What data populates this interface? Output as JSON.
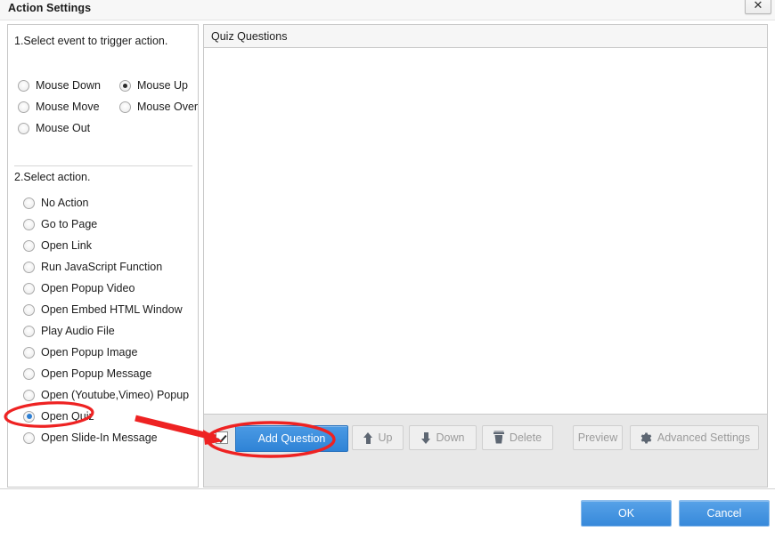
{
  "window": {
    "title": "Action Settings",
    "close_icon": "close-icon",
    "close_glyph": "✕"
  },
  "left_panel": {
    "section1_title": "1.Select event to trigger action.",
    "section2_title": "2.Select action.",
    "events": [
      {
        "label": "Mouse Down",
        "selected": false
      },
      {
        "label": "Mouse Up",
        "selected": true
      },
      {
        "label": "Mouse Move",
        "selected": false
      },
      {
        "label": "Mouse Over",
        "selected": false
      },
      {
        "label": "Mouse Out",
        "selected": false
      }
    ],
    "actions": [
      {
        "label": "No Action",
        "selected": false
      },
      {
        "label": "Go to Page",
        "selected": false
      },
      {
        "label": "Open Link",
        "selected": false
      },
      {
        "label": "Run JavaScript Function",
        "selected": false
      },
      {
        "label": "Open Popup Video",
        "selected": false
      },
      {
        "label": "Open Embed HTML Window",
        "selected": false
      },
      {
        "label": "Play Audio File",
        "selected": false
      },
      {
        "label": "Open Popup Image",
        "selected": false
      },
      {
        "label": "Open Popup Message",
        "selected": false
      },
      {
        "label": "Open (Youtube,Vimeo) Popup",
        "selected": false
      },
      {
        "label": "Open Quiz",
        "selected": true
      },
      {
        "label": "Open Slide-In Message",
        "selected": false
      }
    ]
  },
  "right_panel": {
    "header_label": "Quiz Questions",
    "questions": []
  },
  "toolbar": {
    "select_all_checked": true,
    "add_question_label": "Add Question",
    "up_label": "Up",
    "up_icon": "arrow-up-icon",
    "down_label": "Down",
    "down_icon": "arrow-down-icon",
    "delete_label": "Delete",
    "delete_icon": "trash-icon",
    "preview_label": "Preview",
    "advanced_settings_label": "Advanced Settings",
    "advanced_settings_icon": "gear-icon"
  },
  "footer": {
    "ok_label": "OK",
    "cancel_label": "Cancel"
  },
  "colors": {
    "primary_blue": "#2f83d6",
    "dialog_blue": "#3789da",
    "annotation_red": "#ee2222",
    "panel_grey": "#e8e8e8",
    "disabled_text": "#9b9b9b"
  },
  "annotations": {
    "ellipse_open_quiz": "red-ellipse-open-quiz",
    "ellipse_add_question": "red-ellipse-add-question",
    "arrow": "red-arrow"
  }
}
